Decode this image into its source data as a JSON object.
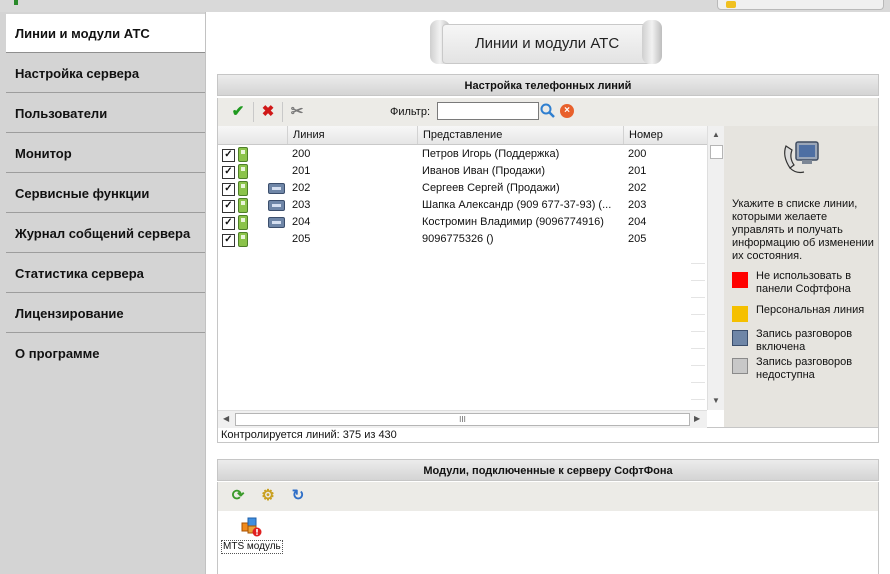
{
  "sidebar": {
    "items": [
      {
        "label": "Линии и модули АТС",
        "active": true
      },
      {
        "label": "Настройка сервера"
      },
      {
        "label": "Пользователи"
      },
      {
        "label": "Монитор"
      },
      {
        "label": "Сервисные функции"
      },
      {
        "label": "Журнал собщений сервера"
      },
      {
        "label": "Статистика сервера"
      },
      {
        "label": "Лицензирование"
      },
      {
        "label": "О программе"
      }
    ]
  },
  "page_title": "Линии и модули АТС",
  "lines_panel": {
    "title": "Настройка телефонных линий",
    "filter_label": "Фильтр:",
    "filter_value": "",
    "columns": [
      "Линия",
      "Представление",
      "Номер"
    ],
    "rows": [
      {
        "line": "200",
        "name": "Петров Игорь (Поддержка)",
        "number": "200",
        "checked": true,
        "recording": false
      },
      {
        "line": "201",
        "name": "Иванов Иван (Продажи)",
        "number": "201",
        "checked": true,
        "recording": false
      },
      {
        "line": "202",
        "name": "Сергеев Сергей (Продажи)",
        "number": "202",
        "checked": true,
        "recording": true
      },
      {
        "line": "203",
        "name": "Шапка Александр (909 677-37-93) (...",
        "number": "203",
        "checked": true,
        "recording": true
      },
      {
        "line": "204",
        "name": "Костромин Владимир (9096774916)",
        "number": "204",
        "checked": true,
        "recording": true
      },
      {
        "line": "205",
        "name": "9096775326  ()",
        "number": "205",
        "checked": true,
        "recording": false
      }
    ],
    "status": "Контролируется линий: 375 из 430",
    "hscroll_grip": "III"
  },
  "info_panel": {
    "text": "Укажите в списке линии, которыми желаете управлять и получать информацию об изменении их состояния.",
    "legend": [
      {
        "label": "Не использовать в панели Софтфона",
        "color": "#ff0000"
      },
      {
        "label": "Персональная линия",
        "color": "#f5c000"
      },
      {
        "label": "Запись разговоров включена",
        "color": "#6f86a7"
      },
      {
        "label": "Запись разговоров недоступна",
        "color": "#c8c8c8"
      }
    ]
  },
  "modules_panel": {
    "title": "Модули, подключенные к серверу СофтФона",
    "modules": [
      {
        "label": "MTS модуль"
      }
    ]
  },
  "colors": {
    "sidebar_bg": "#d4d4d4",
    "accept_green": "#1f9a1f",
    "delete_red": "#d01818"
  }
}
